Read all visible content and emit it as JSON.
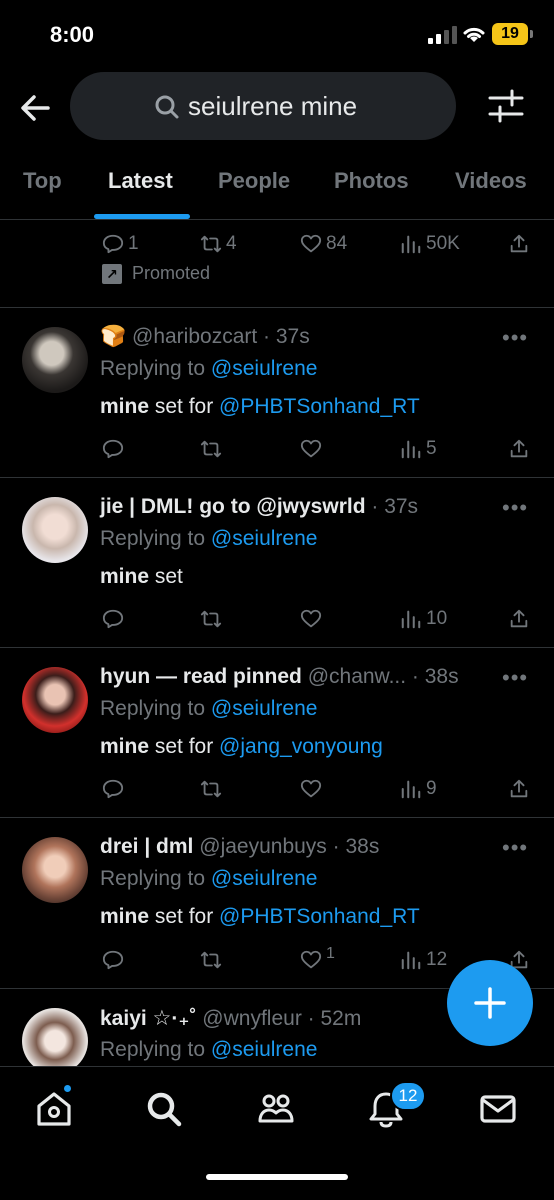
{
  "status": {
    "time": "8:00",
    "battery": "19"
  },
  "search": {
    "query": "seiulrene mine"
  },
  "tabs": [
    "Top",
    "Latest",
    "People",
    "Photos",
    "Videos"
  ],
  "promo": {
    "replies": "1",
    "reposts": "4",
    "likes": "84",
    "views": "50K",
    "promoted_label": "Promoted"
  },
  "posts": [
    {
      "name": "",
      "emoji": "🍞",
      "handle": "@haribozcart",
      "time": "· 37s",
      "replying_label": "Replying to",
      "replying_to": "@seiulrene",
      "body_bold": "mine",
      "body_text": " set for ",
      "mention": "@PHBTSonhand_RT",
      "likes": "",
      "views": "5"
    },
    {
      "name": "jie | DML! go to @jwyswrld",
      "handle": "",
      "time": "· 37s",
      "replying_label": "Replying to",
      "replying_to": "@seiulrene",
      "body_bold": "mine",
      "body_text": " set",
      "mention": "",
      "likes": "",
      "views": "10"
    },
    {
      "name": "hyun — read pinned",
      "handle": "@chanw...",
      "time": "· 38s",
      "replying_label": "Replying to",
      "replying_to": "@seiulrene",
      "body_bold": "mine",
      "body_text": " set for ",
      "mention": "@jang_vonyoung",
      "likes": "",
      "views": "9"
    },
    {
      "name": "drei | dml",
      "handle": "@jaeyunbuys",
      "time": "· 38s",
      "replying_label": "Replying to",
      "replying_to": "@seiulrene",
      "body_bold": "mine",
      "body_text": " set for ",
      "mention": "@PHBTSonhand_RT",
      "likes": "1",
      "views": "12"
    },
    {
      "name": "kaiyi ☆·₊˚",
      "handle": "@wnyfleur",
      "time": "· 52m",
      "replying_label": "Replying to",
      "replying_to": "@seiulrene"
    }
  ],
  "nav": {
    "notifications_count": "12"
  },
  "colors": {
    "accent": "#1d9bf0",
    "background": "#000000",
    "muted": "#71767b",
    "text": "#e7e9ea"
  }
}
